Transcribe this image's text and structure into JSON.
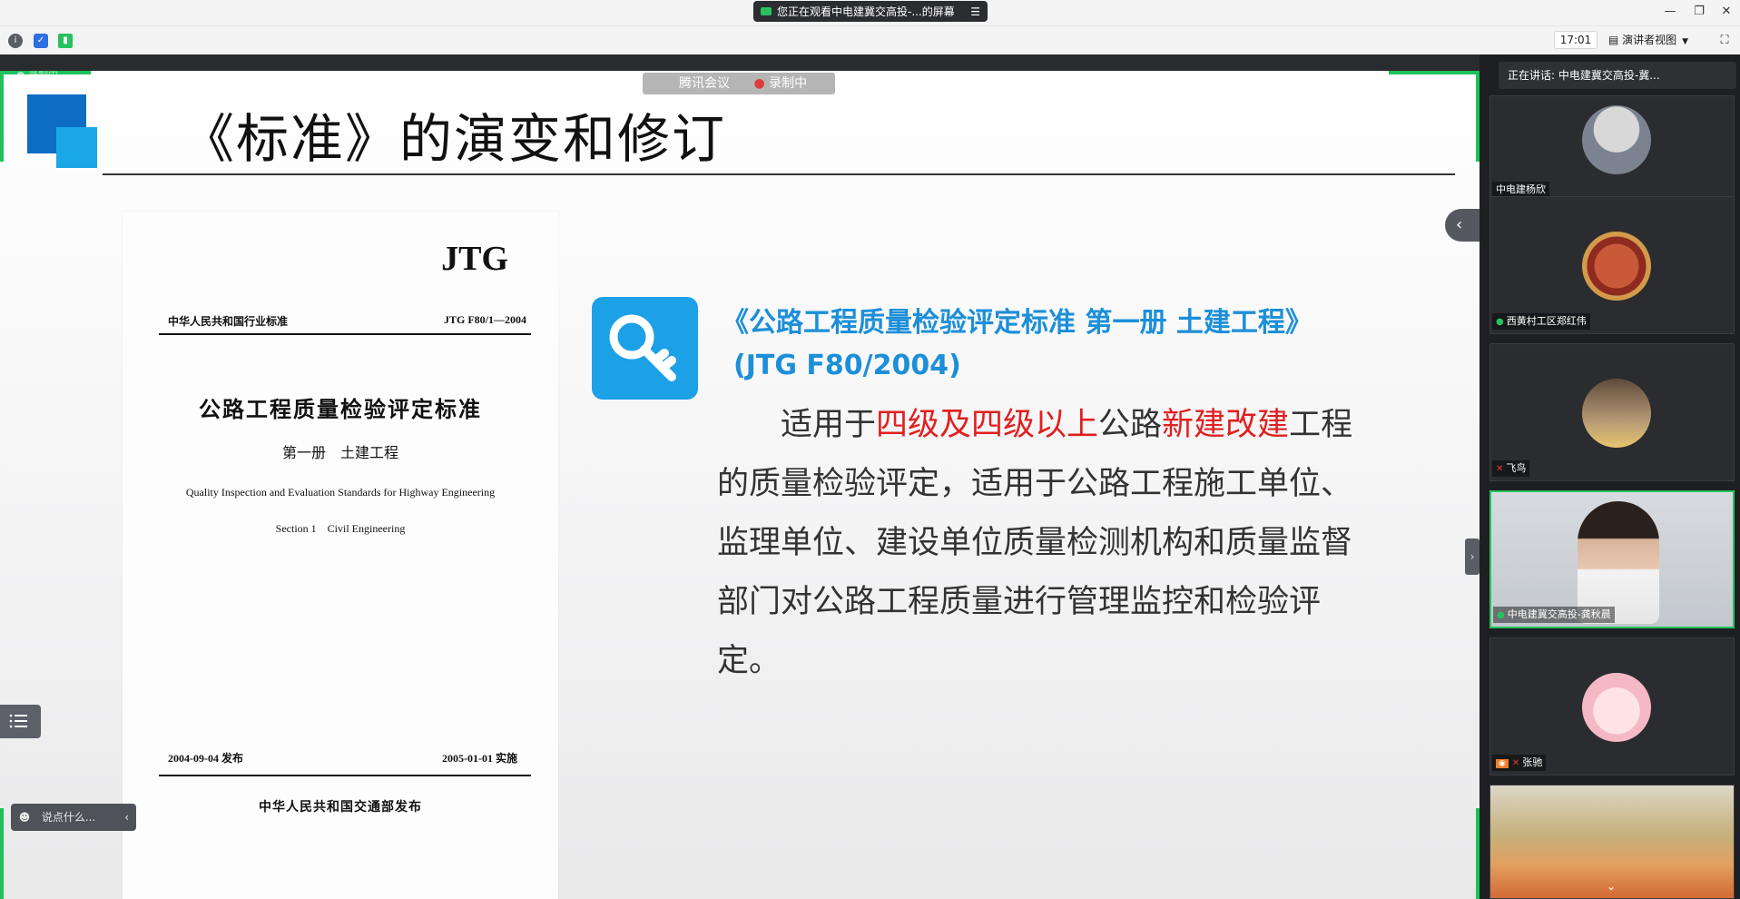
{
  "window": {
    "share_banner": "您正在观看中电建冀交高投-...的屏幕",
    "time": "17:01",
    "view_mode": "演讲者视图"
  },
  "slide": {
    "meeting_badge": "腾讯会议",
    "recording_label": "录制中",
    "recording_corner": "录制中",
    "title": "《标准》的演变和修订",
    "doc": {
      "brand": "JTG",
      "category": "中华人民共和国行业标准",
      "number": "JTG F80/1—2004",
      "title": "公路工程质量检验评定标准",
      "subtitle": "第一册　土建工程",
      "english_title": "Quality Inspection and Evaluation Standards for Highway Engineering",
      "english_section": "Section 1　Civil Engineering",
      "publish_date": "2004-09-04 发布",
      "effective_date": "2005-01-01 实施",
      "issuer": "中华人民共和国交通部发布"
    },
    "standard_title": "《公路工程质量检验评定标准 第一册 土建工程》",
    "standard_code": "(JTG F80/2004)",
    "body": {
      "part1": "适用于",
      "part2": "四级及四级以上",
      "part3": "公路",
      "part4": "新建改建",
      "part5": "工程的质量检验评定，适用于公路工程施工单位、监理单位、建设单位质量检测机构和质量监督部门对公路工程质量进行管理监控和检验评定。"
    },
    "chat_placeholder": "说点什么..."
  },
  "panel": {
    "speaking": "正在讲话: 中电建冀交高投-冀...",
    "participants": [
      {
        "name": "中电建杨欣"
      },
      {
        "name": "西黄村工区郑红伟"
      },
      {
        "name": "飞鸟"
      },
      {
        "name": "中电建冀交高投-龚秋晨"
      },
      {
        "name": "张驰"
      },
      {
        "name": ""
      }
    ]
  },
  "colors": {
    "accent_green": "#1ec15b",
    "title_blue": "#1c8fd9",
    "highlight_red": "#e02020",
    "key_tile_blue": "#1ca0e6"
  }
}
